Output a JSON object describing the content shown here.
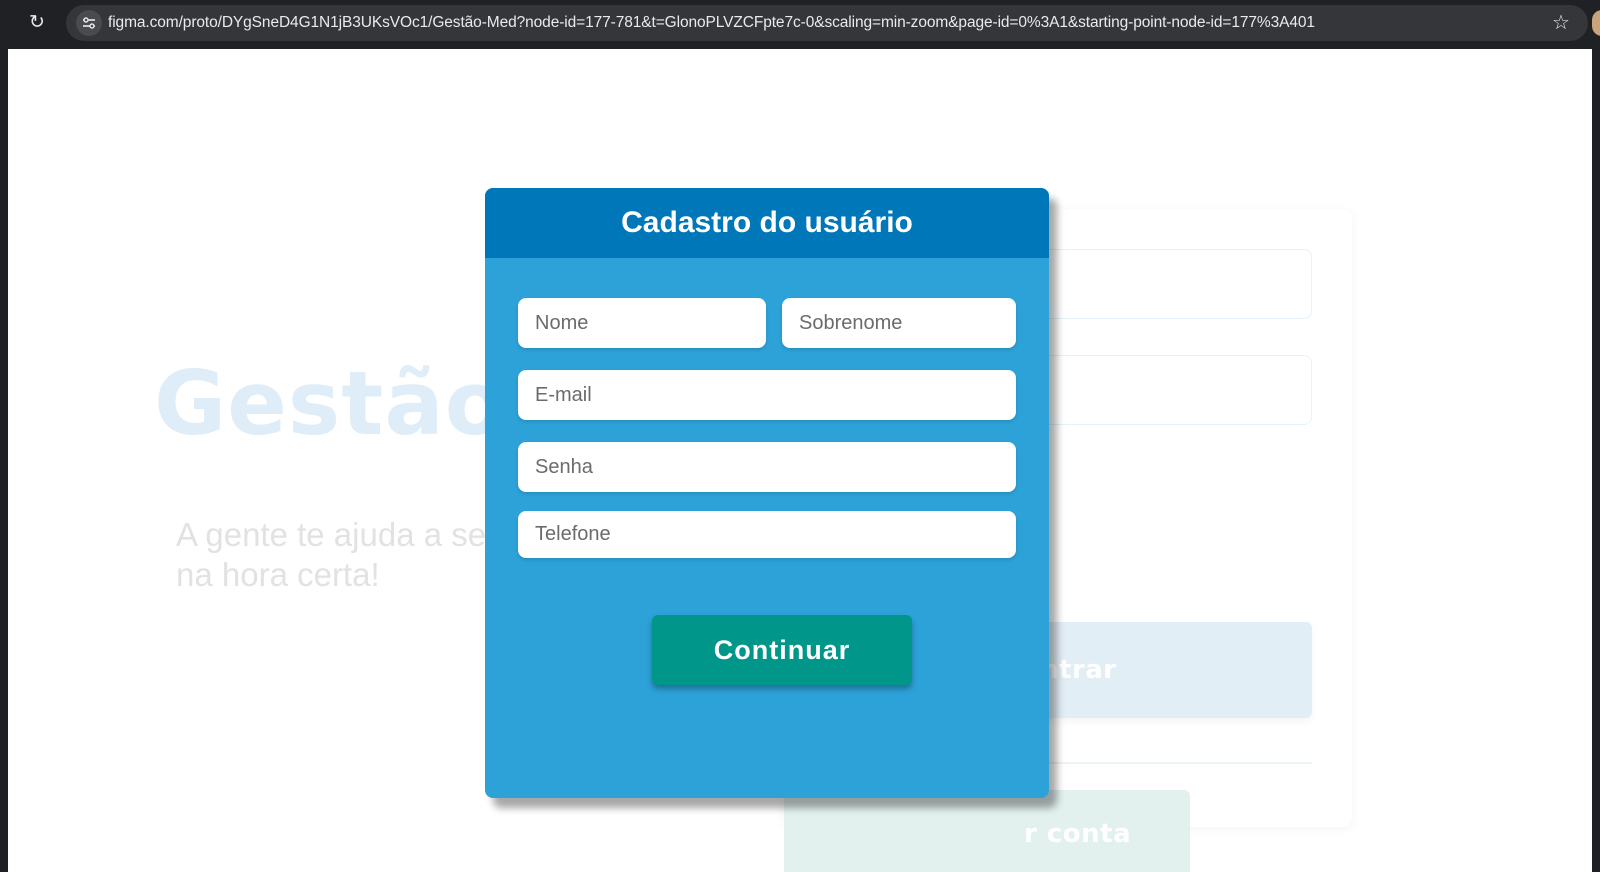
{
  "browser": {
    "url": "figma.com/proto/DYgSneD4G1N1jB3UKsVOc1/Gestão-Med?node-id=177-781&t=GlonoPLVZCFpte7c-0&scaling=min-zoom&page-id=0%3A1&starting-point-node-id=177%3A401",
    "reload_icon": "↻",
    "star_icon": "☆"
  },
  "background": {
    "title": "Gestão",
    "subtitle_line1": "A gente te ajuda a se",
    "subtitle_line2": "na hora certa!",
    "enter_label": "ntrar",
    "create_label": "r conta"
  },
  "modal": {
    "title": "Cadastro do usuário",
    "fields": {
      "first_name_placeholder": "Nome",
      "last_name_placeholder": "Sobrenome",
      "email_placeholder": "E-mail",
      "password_placeholder": "Senha",
      "phone_placeholder": "Telefone"
    },
    "continue_label": "Continuar"
  },
  "colors": {
    "modal_header": "#0077b9",
    "modal_body": "#2ca2d8",
    "continue_button": "#00968a"
  }
}
